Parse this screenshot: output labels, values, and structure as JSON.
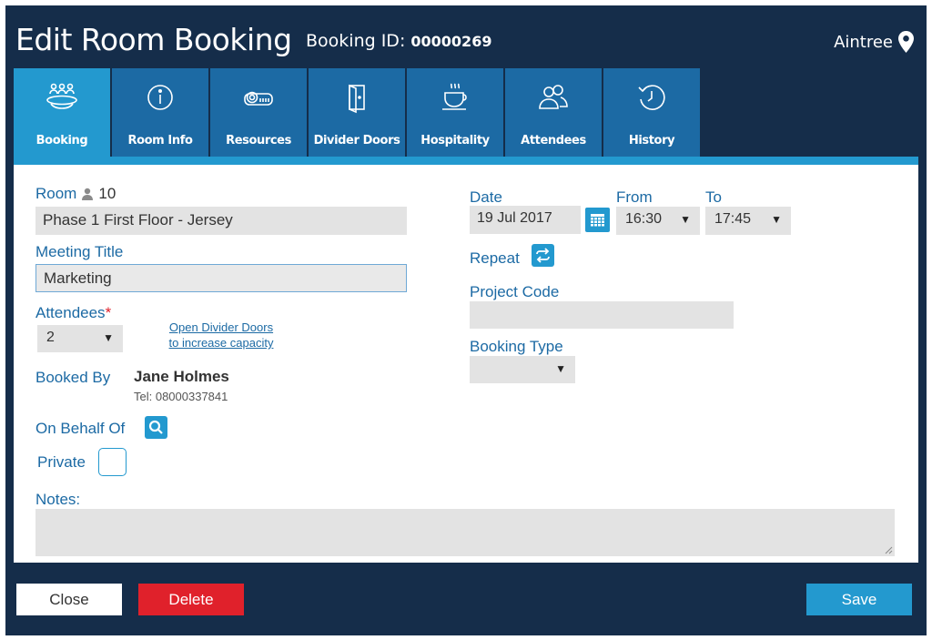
{
  "header": {
    "title": "Edit Room Booking",
    "booking_id_label": "Booking ID:",
    "booking_id": "00000269",
    "location": "Aintree"
  },
  "tabs": [
    {
      "label": "Booking",
      "icon": "table-people-icon",
      "active": true
    },
    {
      "label": "Room Info",
      "icon": "info-icon",
      "active": false
    },
    {
      "label": "Resources",
      "icon": "projector-icon",
      "active": false
    },
    {
      "label": "Divider Doors",
      "icon": "door-icon",
      "active": false
    },
    {
      "label": "Hospitality",
      "icon": "coffee-cup-icon",
      "active": false
    },
    {
      "label": "Attendees",
      "icon": "people-icon",
      "active": false
    },
    {
      "label": "History",
      "icon": "history-clock-icon",
      "active": false
    }
  ],
  "form": {
    "room_label": "Room",
    "room_capacity": "10",
    "room_value": "Phase 1 First Floor - Jersey",
    "meeting_title_label": "Meeting Title",
    "meeting_title_value": "Marketing",
    "attendees_label": "Attendees",
    "attendees_required": "*",
    "attendees_value": "2",
    "divider_link_line1": "Open Divider Doors",
    "divider_link_line2": "to increase capacity",
    "booked_by_label": "Booked By",
    "booked_by_name": "Jane Holmes",
    "booked_by_tel": "Tel: 08000337841",
    "on_behalf_label": "On Behalf Of",
    "private_label": "Private",
    "notes_label": "Notes:",
    "notes_value": "",
    "date_label": "Date",
    "date_value": "19 Jul 2017",
    "from_label": "From",
    "from_value": "16:30",
    "to_label": "To",
    "to_value": "17:45",
    "repeat_label": "Repeat",
    "project_code_label": "Project Code",
    "project_code_value": "",
    "booking_type_label": "Booking Type",
    "booking_type_value": ""
  },
  "footer": {
    "close_label": "Close",
    "delete_label": "Delete",
    "save_label": "Save"
  },
  "colors": {
    "navy": "#152d4a",
    "tab_blue": "#1c6aa4",
    "accent_blue": "#2399cf",
    "delete_red": "#e0212b",
    "field_grey": "#e3e3e3"
  }
}
